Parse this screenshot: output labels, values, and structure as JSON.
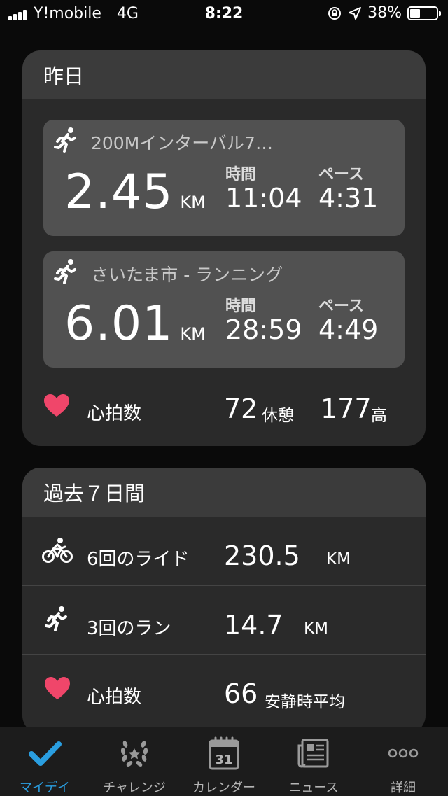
{
  "status_bar": {
    "carrier": "Y!mobile",
    "network": "4G",
    "time": "8:22",
    "battery": "38%"
  },
  "yesterday": {
    "title": "昨日",
    "activities": [
      {
        "name": "200Mインターバル7…",
        "distance": "2.45",
        "distance_unit": "KM",
        "time_label": "時間",
        "time": "11:04",
        "pace_label": "ペース",
        "pace": "4:31"
      },
      {
        "name": "さいたま市 - ランニング",
        "distance": "6.01",
        "distance_unit": "KM",
        "time_label": "時間",
        "time": "28:59",
        "pace_label": "ペース",
        "pace": "4:49"
      }
    ],
    "heart_rate": {
      "label": "心拍数",
      "resting": "72",
      "resting_label": "休憩",
      "high": "177",
      "high_label": "高"
    }
  },
  "week": {
    "title": "過去７日間",
    "rows": [
      {
        "icon": "bike-icon",
        "label": "6回のライド",
        "value": "230.5",
        "unit": "KM"
      },
      {
        "icon": "run-icon",
        "label": "3回のラン",
        "value": "14.7",
        "unit": "KM"
      },
      {
        "icon": "heart-icon",
        "label": "心拍数",
        "value": "66",
        "unit": "安静時平均"
      }
    ]
  },
  "tabs": [
    {
      "label": "マイデイ",
      "icon": "check-icon",
      "active": true
    },
    {
      "label": "チャレンジ",
      "icon": "laurel-icon",
      "active": false
    },
    {
      "label": "カレンダー",
      "icon": "calendar-icon",
      "calendar_day": "31",
      "active": false
    },
    {
      "label": "ニュース",
      "icon": "news-icon",
      "active": false
    },
    {
      "label": "詳細",
      "icon": "more-icon",
      "active": false
    }
  ],
  "colors": {
    "accent": "#2a9ee0",
    "heart": "#f0466a",
    "card": "#2a2a2a",
    "activity_tile": "#515151"
  }
}
